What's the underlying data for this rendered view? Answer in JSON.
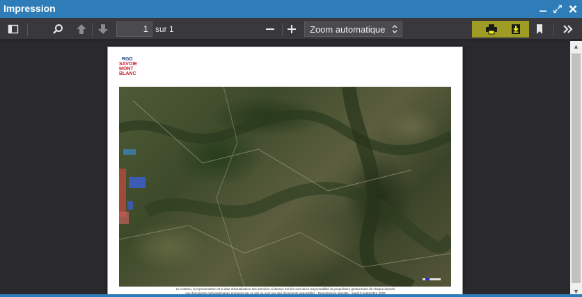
{
  "window": {
    "title": "Impression",
    "controls": [
      "minimize-icon",
      "maximize-icon",
      "close-icon"
    ]
  },
  "toolbar": {
    "sidebar_icon": "sidebar-toggle-icon",
    "search_icon": "search-icon",
    "prev_icon": "arrow-up-icon",
    "next_icon": "arrow-down-icon",
    "page_number": "1",
    "page_count_label": "sur 1",
    "zoom_out_icon": "minus-icon",
    "zoom_in_icon": "plus-icon",
    "zoom_value": "Zoom automatique",
    "print_icon": "print-icon",
    "download_icon": "download-icon",
    "bookmark_icon": "bookmark-icon",
    "more_icon": "double-chevron-right-icon",
    "highlight_color": "#bcb820"
  },
  "document": {
    "logo": {
      "line1": "RGD",
      "line2": "SAVOIE",
      "line3": "MONT",
      "line4": "BLANC"
    },
    "footer_line1": "Le contenu, la représentation et la date d'actualisation des données ci-dessus est liée sont de la responsabilité du propriétaire gestionnaire de chaque donnée",
    "footer_line2": "Les documents cartographiques proposés par ce site ne sont pas des documents opposables - Reproduction interdite - mardi 5 septembre 2023"
  },
  "colors": {
    "titlebar": "#2f7db8",
    "toolbar": "#38383d",
    "viewer_bg": "#2a2a2e"
  }
}
